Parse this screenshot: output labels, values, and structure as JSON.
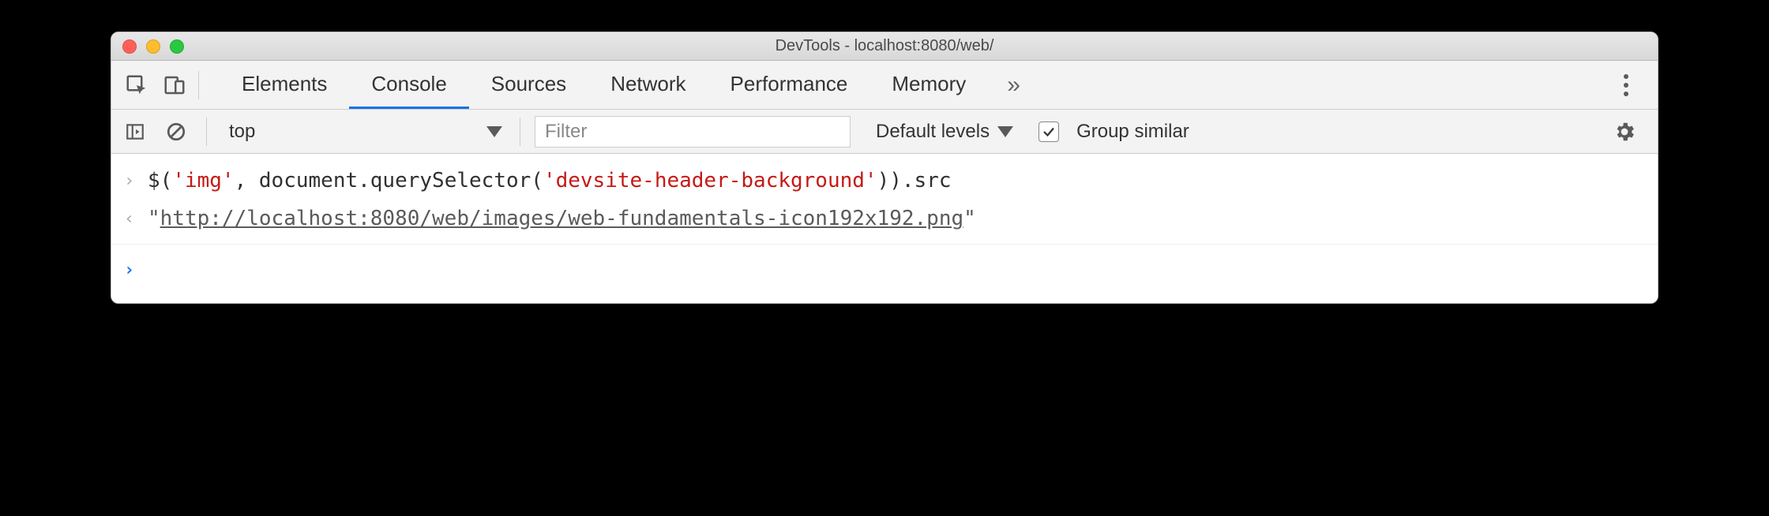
{
  "window": {
    "title": "DevTools - localhost:8080/web/"
  },
  "tabs": {
    "items": [
      "Elements",
      "Console",
      "Sources",
      "Network",
      "Performance",
      "Memory"
    ],
    "active_index": 1,
    "overflow_glyph": "»"
  },
  "toolbar": {
    "context": "top",
    "filter_placeholder": "Filter",
    "levels_label": "Default levels",
    "group_similar_checked": true,
    "group_similar_label": "Group similar"
  },
  "console": {
    "input_prefix": "$(",
    "input_str1": "'img'",
    "input_mid": ", document.querySelector(",
    "input_str2": "'devsite-header-background'",
    "input_suffix": ")).src",
    "output_open_quote": "\"",
    "output_url": "http://localhost:8080/web/images/web-fundamentals-icon192x192.png",
    "output_close_quote": "\"",
    "prompt_glyph": "›",
    "return_glyph": "‹",
    "new_prompt_glyph": "›"
  }
}
